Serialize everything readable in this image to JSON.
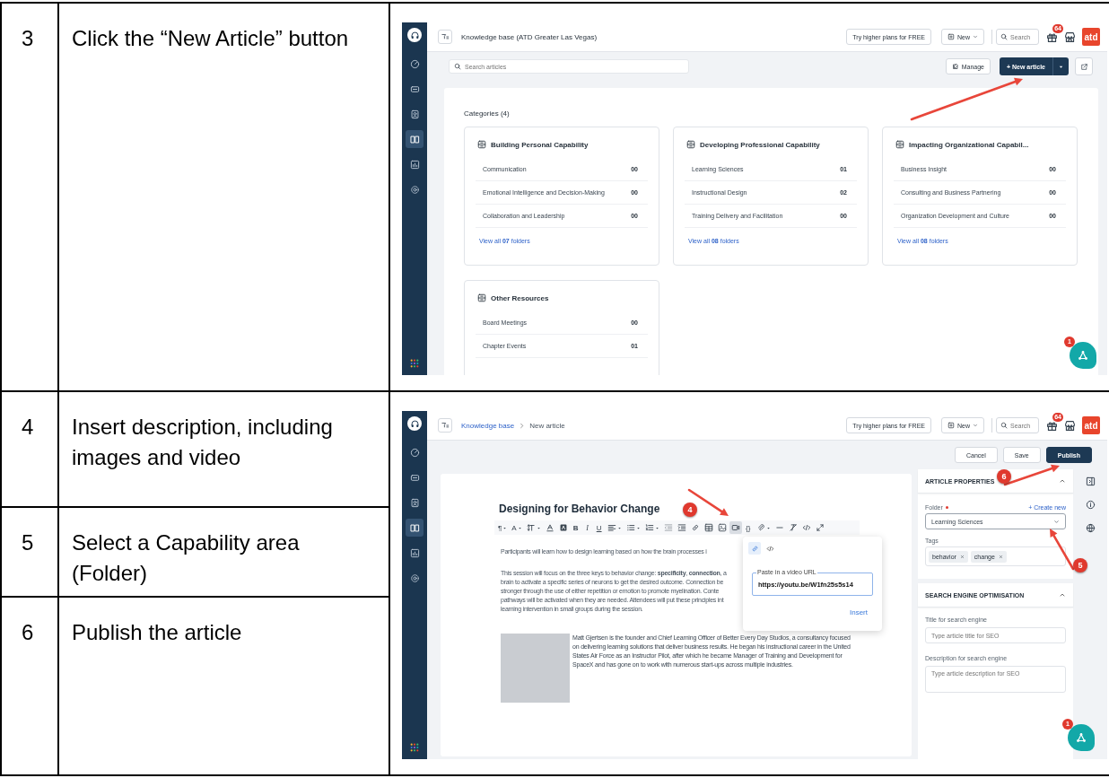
{
  "rows": [
    {
      "steps": [
        {
          "number": "3",
          "instruction": "Click the “New Article” button"
        }
      ],
      "screen": {
        "sidebar": [
          {
            "kind": "dashboard",
            "selected": false
          },
          {
            "kind": "tickets",
            "selected": false
          },
          {
            "kind": "contacts",
            "selected": false
          },
          {
            "kind": "knowledge",
            "selected": true
          },
          {
            "kind": "reports",
            "selected": false
          },
          {
            "kind": "settings",
            "selected": false
          }
        ],
        "header": {
          "title": "Knowledge base (ATD Greater Las Vegas)",
          "upgrade_button": "Try higher plans for FREE",
          "new_button": "New",
          "search_placeholder": "Search",
          "gift_badge": "64",
          "logo": "atd"
        },
        "toolbar": {
          "search_placeholder": "Search articles",
          "manage_button": "Manage",
          "new_article_button": "+ New article"
        },
        "categories_heading": "Categories (4)",
        "categories": [
          {
            "title": "Building Personal Capability",
            "folders": [
              {
                "name": "Communication",
                "count": "00"
              },
              {
                "name": "Emotional Intelligence and Decision-Making",
                "count": "00"
              },
              {
                "name": "Collaboration and Leadership",
                "count": "00"
              }
            ],
            "view_all": "View all **07** folders"
          },
          {
            "title": "Developing Professional Capability",
            "folders": [
              {
                "name": "Learning Sciences",
                "count": "01"
              },
              {
                "name": "Instructional Design",
                "count": "02"
              },
              {
                "name": "Training Delivery and Facilitation",
                "count": "00"
              }
            ],
            "view_all": "View all **08** folders"
          },
          {
            "title": "Impacting Organizational Capabil...",
            "folders": [
              {
                "name": "Business Insight",
                "count": "00"
              },
              {
                "name": "Consulting and Business Partnering",
                "count": "00"
              },
              {
                "name": "Organization Development and Culture",
                "count": "00"
              }
            ],
            "view_all": "View all **08** folders"
          },
          {
            "title": "Other Resources",
            "folders": [
              {
                "name": "Board Meetings",
                "count": "00"
              },
              {
                "name": "Chapter Events",
                "count": "01"
              }
            ]
          }
        ],
        "chat_badge": "1"
      }
    },
    {
      "steps": [
        {
          "number": "4",
          "instruction": "Insert description, including images and video"
        },
        {
          "number": "5",
          "instruction": "Select a Capability area (Folder)"
        },
        {
          "number": "6",
          "instruction": "Publish the article"
        }
      ],
      "screen": {
        "sidebar": [
          {
            "kind": "dashboard",
            "selected": false
          },
          {
            "kind": "tickets",
            "selected": false
          },
          {
            "kind": "contacts",
            "selected": false
          },
          {
            "kind": "knowledge",
            "selected": true
          },
          {
            "kind": "reports",
            "selected": false
          },
          {
            "kind": "settings",
            "selected": false
          }
        ],
        "header": {
          "breadcrumb": [
            {
              "label": "Knowledge base",
              "link": true
            },
            {
              "label": "New article",
              "link": false
            }
          ],
          "upgrade_button": "Try higher plans for FREE",
          "new_button": "New",
          "search_placeholder": "Search",
          "gift_badge": "64",
          "logo": "atd"
        },
        "actions": [
          {
            "label": "Cancel",
            "kind": "secondary"
          },
          {
            "label": "Save",
            "kind": "secondary"
          },
          {
            "label": "Publish",
            "kind": "primary"
          }
        ],
        "editor": {
          "title": "Designing for Behavior Change",
          "tools": [
            {
              "kind": "glyph",
              "text": "¶",
              "menu": true,
              "selected": false
            },
            {
              "kind": "glyph",
              "text": "A",
              "menu": true,
              "selected": false
            },
            {
              "kind": "line-height",
              "menu": true,
              "selected": false
            },
            {
              "kind": "text-color",
              "selected": false
            },
            {
              "kind": "highlight",
              "selected": false
            },
            {
              "kind": "bold",
              "text": "B",
              "selected": false
            },
            {
              "kind": "italic",
              "text": "I",
              "selected": false
            },
            {
              "kind": "underline",
              "text": "U",
              "selected": false
            },
            {
              "kind": "align",
              "menu": true,
              "selected": false
            },
            {
              "kind": "bullets",
              "menu": true,
              "selected": false
            },
            {
              "kind": "numbers",
              "menu": true,
              "selected": false
            },
            {
              "kind": "outdent",
              "selected": false
            },
            {
              "kind": "indent",
              "selected": false
            },
            {
              "kind": "link",
              "selected": false
            },
            {
              "kind": "table",
              "selected": false
            },
            {
              "kind": "image",
              "selected": false
            },
            {
              "kind": "video",
              "selected": true
            },
            {
              "kind": "glyph",
              "text": "{}",
              "selected": false
            },
            {
              "kind": "attachment",
              "menu": true,
              "selected": false
            },
            {
              "kind": "rule",
              "selected": false
            },
            {
              "kind": "clear",
              "selected": false
            },
            {
              "kind": "code",
              "selected": false
            },
            {
              "kind": "expand",
              "selected": false
            }
          ],
          "paragraphs": [
            {
              "lines": [
                "Participants will learn how to design learning based on how the brain processes i"
              ]
            },
            {
              "lines": [
                "This session will focus on the three keys to behavior change: **specificity**, **connection**, a",
                "brain to activate a specific series of neurons to get the desired outcome. Connection be",
                "stronger through the use of either repetition or emotion to promote myelination. Conte",
                "pathways will be activated when they are needed. Attendees will put these principles int",
                "learning intervention in small groups during the session."
              ]
            }
          ],
          "bio": "Matt Gjertsen is the founder and Chief Learning Officer of Better Every Day Studios, a consultancy focused on delivering learning solutions that deliver business results. He began his instructional career in the United States Air Force as an Instructor Pilot, after which he became Manager of Training and Development for SpaceX and has gone on to work with numerous start-ups across multiple industries.",
          "video_popup": {
            "tabs": [
              {
                "kind": "link",
                "selected": true
              },
              {
                "kind": "embed",
                "selected": false
              }
            ],
            "field_label": "Paste in a video URL",
            "value": "https://youtu.be/W1fn25s5s14",
            "button": "Insert"
          }
        },
        "article_properties": {
          "title": "ARTICLE PROPERTIES",
          "expanded": true,
          "folder_label": "Folder",
          "required": true,
          "create_new": "+ Create new",
          "folder_value": "Learning Sciences",
          "tags_label": "Tags",
          "tags": [
            "behavior",
            "change"
          ]
        },
        "seo": {
          "title": "SEARCH ENGINE OPTIMISATION",
          "expanded": true,
          "fields": [
            {
              "kind": "input",
              "label": "Title for search engine",
              "placeholder": "Type article title for SEO"
            },
            {
              "kind": "textarea",
              "label": "Description for search engine",
              "placeholder": "Type article description for SEO"
            }
          ]
        },
        "markers": [
          "4",
          "6",
          "5"
        ],
        "chat_badge": "1"
      }
    }
  ]
}
